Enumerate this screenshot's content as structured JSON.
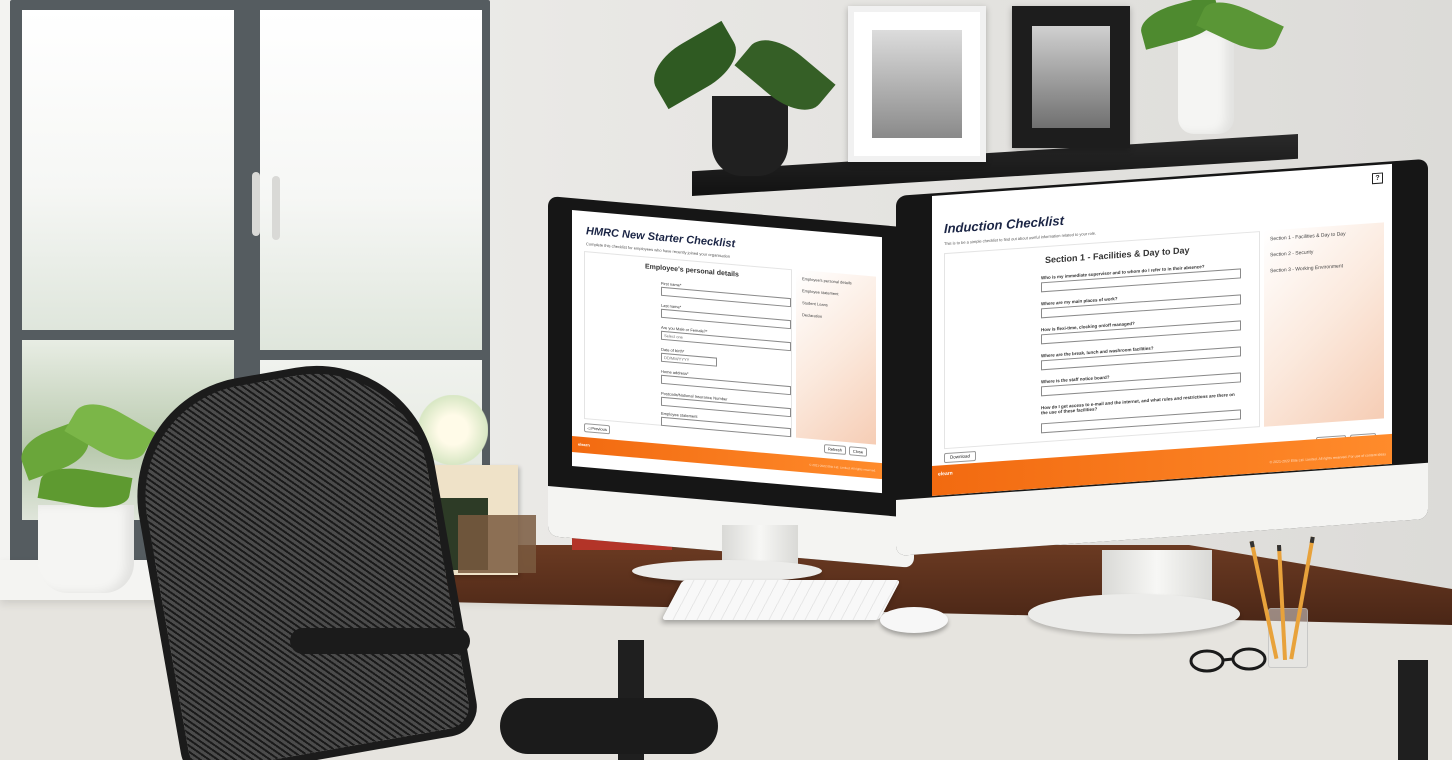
{
  "left_app": {
    "title": "HMRC New Starter Checklist",
    "subtitle": "Complete this checklist for employees who have recently joined your organisation",
    "form_heading": "Employee's personal details",
    "fields": [
      {
        "label": "First name*",
        "type": "text",
        "value": ""
      },
      {
        "label": "Last name*",
        "type": "text",
        "value": ""
      },
      {
        "label": "Are you Male or Female?*",
        "type": "select",
        "value": "Select one"
      },
      {
        "label": "Date of birth*",
        "type": "date",
        "value": "DD/MM/YYYY"
      },
      {
        "label": "Home address*",
        "type": "text",
        "value": ""
      },
      {
        "label": "Postcode/National Insurance Number",
        "type": "text",
        "value": ""
      },
      {
        "label": "Employee statement",
        "type": "select",
        "value": ""
      }
    ],
    "sidebar_items": [
      "Employee's personal details",
      "Employee statement",
      "Student Loans",
      "Declaration"
    ],
    "buttons": {
      "previous": "◁ Previous",
      "refresh": "Refresh",
      "close": "Close"
    },
    "logo": "elearn",
    "footer": "© 2021-2022 Elite Ltd. Limited. All rights reserved."
  },
  "right_app": {
    "title": "Induction Checklist",
    "subtitle": "This is to be a simple checklist to find out about useful information related to your role.",
    "help_label": "?",
    "section_heading": "Section 1 - Facilities & Day to Day",
    "questions": [
      "Who is my immediate supervisor and to whom do I refer to in their absence?",
      "Where are my main places of work?",
      "How is flexi-time, clocking on/off managed?",
      "Where are the break, lunch and washroom facilities?",
      "Where is the staff notice board?",
      "How do I get access to e-mail and the internet, and what rules and restrictions are there on the use of these facilities?"
    ],
    "sidebar_items": [
      "Section 1 - Facilities & Day to Day",
      "Section 2 - Security",
      "Section 3 - Working Environment"
    ],
    "buttons": {
      "download": "Download",
      "refresh": "Refresh",
      "close": "Close"
    },
    "logo": "elearn",
    "footer": "© 2021-2022 Elite Ltd. Limited. All rights reserved. For use of content ideas"
  },
  "colors": {
    "accent_orange": "#f26a10",
    "title_navy": "#1b2545",
    "sidebar_peach": "#fbe9dd",
    "desk_wood": "#5a2e1a"
  }
}
